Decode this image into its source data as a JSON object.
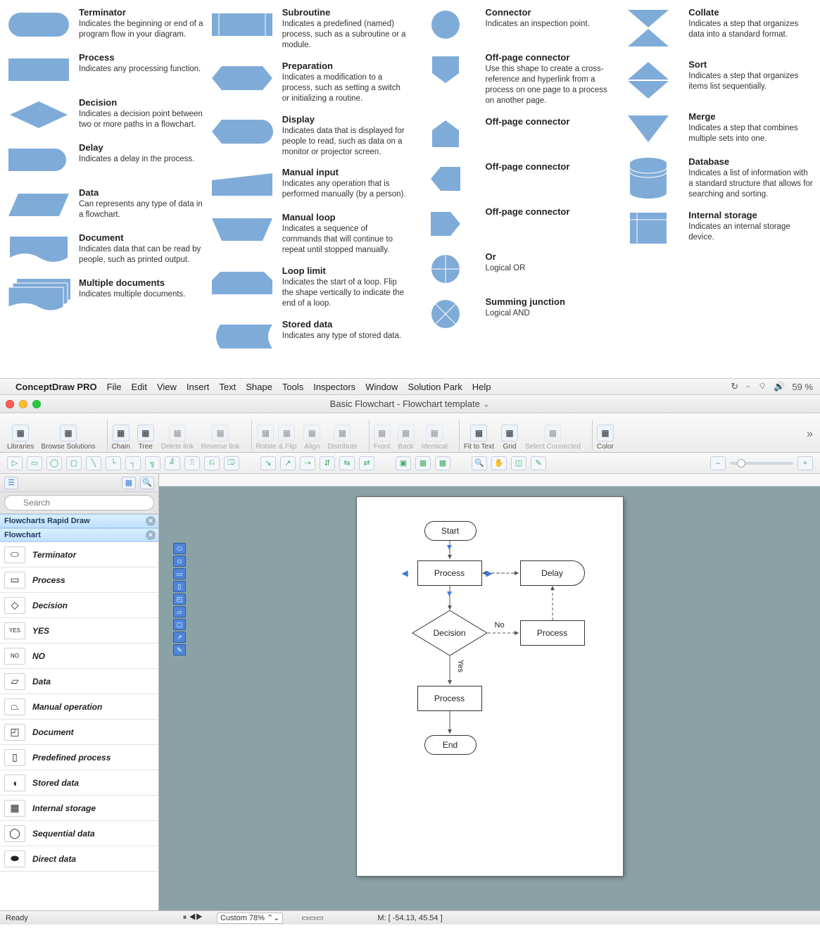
{
  "reference": {
    "col1": [
      {
        "title": "Terminator",
        "desc": "Indicates the beginning or end of a program flow in your diagram."
      },
      {
        "title": "Process",
        "desc": "Indicates any processing function."
      },
      {
        "title": "Decision",
        "desc": "Indicates a decision point between two or more paths in a flowchart."
      },
      {
        "title": "Delay",
        "desc": "Indicates a delay in the process."
      },
      {
        "title": "Data",
        "desc": "Can represents any type of data in a flowchart."
      },
      {
        "title": "Document",
        "desc": "Indicates data that can be read by people, such as printed output."
      },
      {
        "title": "Multiple documents",
        "desc": "Indicates multiple documents."
      }
    ],
    "col2": [
      {
        "title": "Subroutine",
        "desc": "Indicates a predefined (named) process, such as a subroutine or a module."
      },
      {
        "title": "Preparation",
        "desc": "Indicates a modification to a process, such as setting a switch or initializing a routine."
      },
      {
        "title": "Display",
        "desc": "Indicates data that is displayed for people to read, such as data on a monitor or projector screen."
      },
      {
        "title": "Manual input",
        "desc": "Indicates any operation that is performed manually (by a person)."
      },
      {
        "title": "Manual loop",
        "desc": "Indicates a sequence of commands that will continue to repeat until stopped manually."
      },
      {
        "title": "Loop limit",
        "desc": "Indicates the start of a loop. Flip the shape vertically to indicate the end of a loop."
      },
      {
        "title": "Stored data",
        "desc": "Indicates any type of stored data."
      }
    ],
    "col3": [
      {
        "title": "Connector",
        "desc": "Indicates an inspection point."
      },
      {
        "title": "Off-page connector",
        "desc": "Use this shape to create a cross-reference and hyperlink from a process on one page to a process on another page."
      },
      {
        "title": "Off-page connector",
        "desc": ""
      },
      {
        "title": "Off-page connector",
        "desc": ""
      },
      {
        "title": "Off-page connector",
        "desc": ""
      },
      {
        "title": "Or",
        "desc": "Logical OR"
      },
      {
        "title": "Summing junction",
        "desc": "Logical AND"
      }
    ],
    "col4": [
      {
        "title": "Collate",
        "desc": "Indicates a step that organizes data into a standard format."
      },
      {
        "title": "Sort",
        "desc": "Indicates a step that organizes items list sequentially."
      },
      {
        "title": "Merge",
        "desc": "Indicates a step that combines multiple sets into one."
      },
      {
        "title": "Database",
        "desc": "Indicates a list of information with a standard structure that allows for searching and sorting."
      },
      {
        "title": "Internal storage",
        "desc": "Indicates an internal storage device."
      }
    ]
  },
  "menubar": {
    "app": "ConceptDraw PRO",
    "items": [
      "File",
      "Edit",
      "View",
      "Insert",
      "Text",
      "Shape",
      "Tools",
      "Inspectors",
      "Window",
      "Solution Park",
      "Help"
    ],
    "battery": "59 %"
  },
  "doc_title": "Basic Flowchart - Flowchart template",
  "toolbar_groups": [
    {
      "label": "Libraries",
      "n": 1
    },
    {
      "label": "Browse Solutions",
      "n": 1
    },
    {
      "sep": true
    },
    {
      "label": "Chain",
      "n": 1
    },
    {
      "label": "Tree",
      "n": 1
    },
    {
      "label": "Delete link",
      "n": 1,
      "dis": true
    },
    {
      "label": "Reverse link",
      "n": 1,
      "dis": true
    },
    {
      "sep": true
    },
    {
      "label": "Rotate & Flip",
      "n": 2,
      "dis": true
    },
    {
      "label": "Align",
      "n": 1,
      "dis": true
    },
    {
      "label": "Distribute",
      "n": 1,
      "dis": true
    },
    {
      "sep": true
    },
    {
      "label": "Front",
      "n": 1,
      "dis": true
    },
    {
      "label": "Back",
      "n": 1,
      "dis": true
    },
    {
      "label": "Identical",
      "n": 1,
      "dis": true
    },
    {
      "sep": true
    },
    {
      "label": "Fit to Text",
      "n": 1
    },
    {
      "label": "Grid",
      "n": 1
    },
    {
      "label": "Select Connected",
      "n": 1,
      "dis": true
    },
    {
      "sep": true
    },
    {
      "label": "Color",
      "n": 1
    }
  ],
  "search_placeholder": "Search",
  "lib_sections": [
    "Flowcharts Rapid Draw",
    "Flowchart"
  ],
  "shape_items": [
    "Terminator",
    "Process",
    "Decision",
    "YES",
    "NO",
    "Data",
    "Manual operation",
    "Document",
    "Predefined process",
    "Stored data",
    "Internal storage",
    "Sequential data",
    "Direct data"
  ],
  "canvas": {
    "start": "Start",
    "process": "Process",
    "delay": "Delay",
    "decision": "Decision",
    "no": "No",
    "yes": "Yes",
    "end": "End"
  },
  "status": {
    "ready": "Ready",
    "zoom": "Custom 78%",
    "mouse": "M: [ -54.13, 45.54 ]"
  }
}
